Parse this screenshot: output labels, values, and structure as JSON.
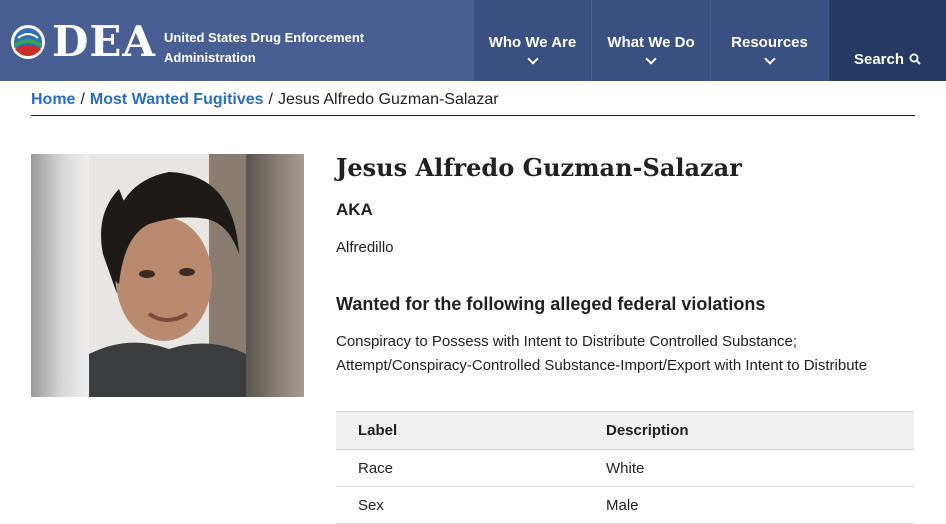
{
  "header": {
    "logo_text": "DEA",
    "agency_line1": "United States Drug Enforcement",
    "agency_line2": "Administration",
    "nav": [
      {
        "label": "Who We Are"
      },
      {
        "label": "What We Do"
      },
      {
        "label": "Resources"
      },
      {
        "label": "Search"
      }
    ],
    "colors": {
      "header_bg": "#495f93",
      "nav_bg": "#3a4f82",
      "search_bg": "#263a63"
    }
  },
  "breadcrumb": {
    "home": "Home",
    "section": "Most Wanted Fugitives",
    "current": "Jesus Alfredo Guzman-Salazar",
    "separator": "/"
  },
  "fugitive": {
    "name": "Jesus Alfredo Guzman-Salazar",
    "aka_heading": "AKA",
    "aka": "Alfredillo",
    "violations_heading": "Wanted for the following alleged federal violations",
    "violations_line1": "Conspiracy to Possess with Intent to Distribute Controlled Substance;",
    "violations_line2": "Attempt/Conspiracy-Controlled Substance-Import/Export with Intent to Distribute"
  },
  "details_table": {
    "headers": [
      "Label",
      "Description"
    ],
    "rows": [
      [
        "Race",
        "White"
      ],
      [
        "Sex",
        "Male"
      ]
    ]
  },
  "colors": {
    "link": "#2a6ebb",
    "text": "#212121"
  }
}
